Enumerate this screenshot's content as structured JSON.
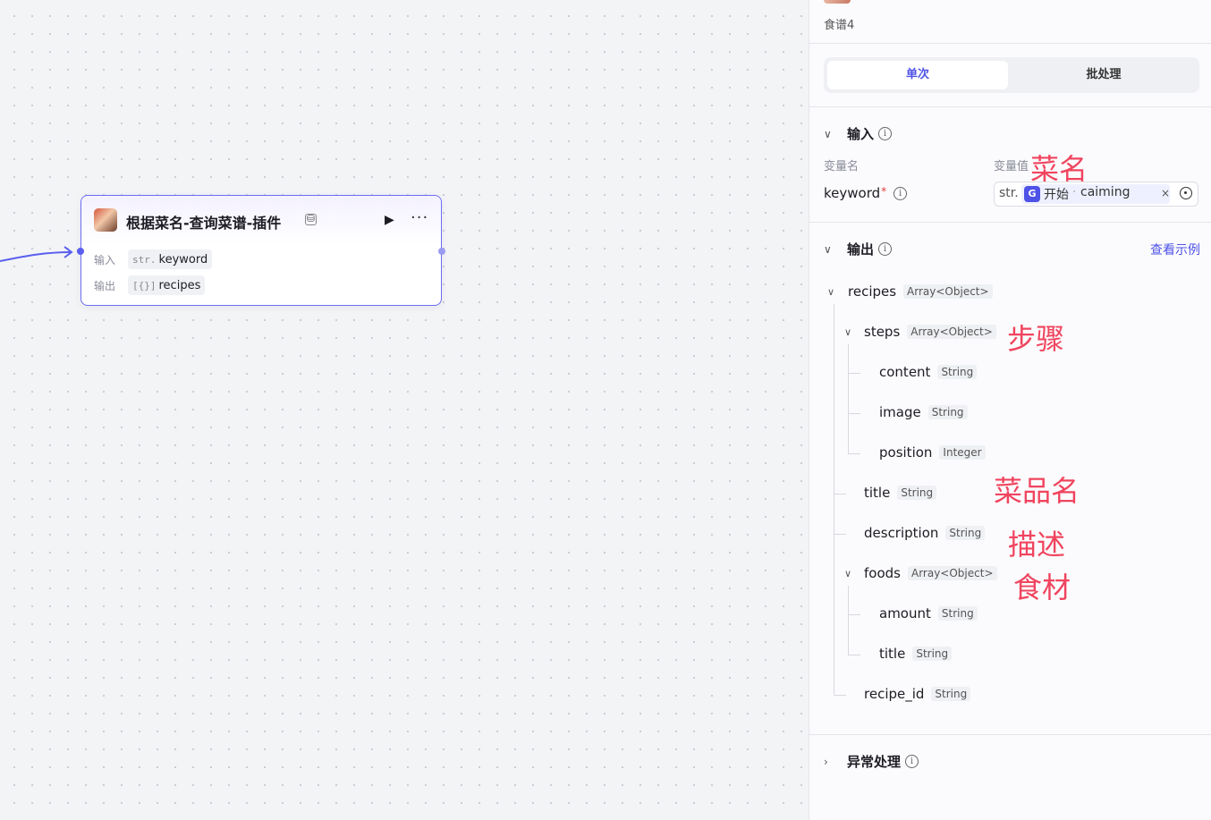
{
  "canvas": {
    "node": {
      "title": "根据菜名-查询菜谱-插件",
      "sub_icon": "⛁",
      "run_icon": "▶",
      "more_icon": "···",
      "input_label": "输入",
      "input_type": "str.",
      "input_value": "keyword",
      "output_label": "输出",
      "output_type": "[{}]",
      "output_value": "recipes"
    }
  },
  "panel": {
    "title": "食谱4",
    "tabs": {
      "single": "单次",
      "batch": "批处理",
      "active": "单次"
    },
    "input": {
      "heading": "输入",
      "col_name": "变量名",
      "col_value": "变量值",
      "var_name": "keyword",
      "required_mark": "*",
      "value_type": "str.",
      "value_source": "开始",
      "value_sep": "·",
      "value_field": "caiming",
      "clear_icon": "×"
    },
    "output": {
      "heading": "输出",
      "example_link": "查看示例",
      "tree": [
        {
          "name": "recipes",
          "type": "Array<Object>"
        },
        {
          "name": "steps",
          "type": "Array<Object>"
        },
        {
          "name": "content",
          "type": "String"
        },
        {
          "name": "image",
          "type": "String"
        },
        {
          "name": "position",
          "type": "Integer"
        },
        {
          "name": "title",
          "type": "String"
        },
        {
          "name": "description",
          "type": "String"
        },
        {
          "name": "foods",
          "type": "Array<Object>"
        },
        {
          "name": "amount",
          "type": "String"
        },
        {
          "name": "title",
          "type": "String"
        },
        {
          "name": "recipe_id",
          "type": "String"
        }
      ]
    },
    "exception": {
      "heading": "异常处理"
    }
  },
  "annotations": {
    "cai_ming": "菜名",
    "bu_zhou": "步骤",
    "cai_pin_ming": "菜品名",
    "miao_shu": "描述",
    "shi_cai": "食材"
  },
  "colors": {
    "accent": "#4e52e6",
    "annotation": "#f0445e",
    "node_border": "#6b6ef0"
  },
  "icons": {
    "expand": "chevron-down-icon",
    "collapse": "chevron-right-icon",
    "info": "info-icon",
    "target": "target-icon"
  }
}
